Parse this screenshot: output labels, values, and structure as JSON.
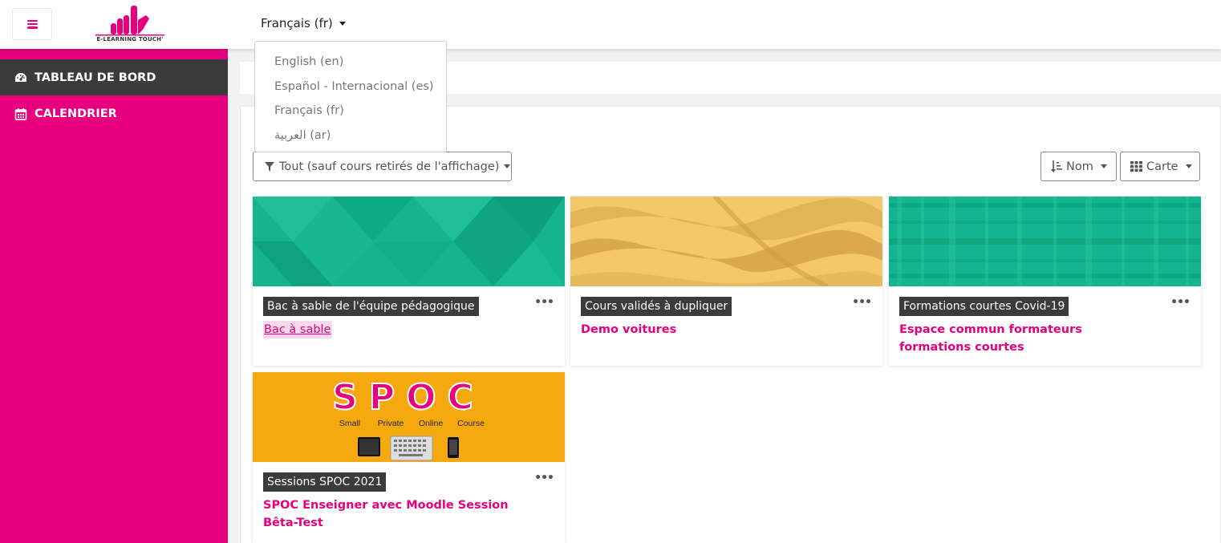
{
  "header": {
    "menu_icon": "hamburger-icon",
    "logo_text": "E-LEARNING TOUCH'",
    "language_current": "Français (fr)"
  },
  "language_menu": {
    "items": [
      {
        "label": "English (en)"
      },
      {
        "label": "Español - Internacional (es)"
      },
      {
        "label": "Français (fr)"
      },
      {
        "label": "العربية (ar)"
      }
    ]
  },
  "sidebar": {
    "items": [
      {
        "label": "TABLEAU DE BORD",
        "icon": "dashboard-icon",
        "active": true
      },
      {
        "label": "CALENDRIER",
        "icon": "calendar-icon",
        "active": false
      }
    ]
  },
  "toolbar": {
    "filter_label": "Tout (sauf cours retirés de l'affichage)",
    "filter_icon": "filter-icon",
    "sort_label": "Nom",
    "sort_icon": "sort-icon",
    "view_label": "Carte",
    "view_icon": "grid-icon"
  },
  "courses": [
    {
      "category": "Bac à sable de l'équipe pédagogique",
      "name": "Bac à sable"
    },
    {
      "category": "Cours validés à dupliquer",
      "name": "Demo voitures"
    },
    {
      "category": "Formations courtes Covid-19",
      "name": "Espace commun formateurs formations courtes"
    },
    {
      "category": "Sessions SPOC 2021",
      "name": "SPOC Enseigner avec Moodle Session Bêta-Test"
    }
  ],
  "spoc_image": {
    "title": "SPOC",
    "words": [
      "Small",
      "Private",
      "Online",
      "Course"
    ]
  },
  "more_menu_label": "•••",
  "colors": {
    "brand": "#e6007e",
    "sidebar_active": "#3b3b3b",
    "card1": "#14b48c",
    "card2": "#f4c76b",
    "card3": "#12b58f",
    "card4": "#f5a90f"
  }
}
